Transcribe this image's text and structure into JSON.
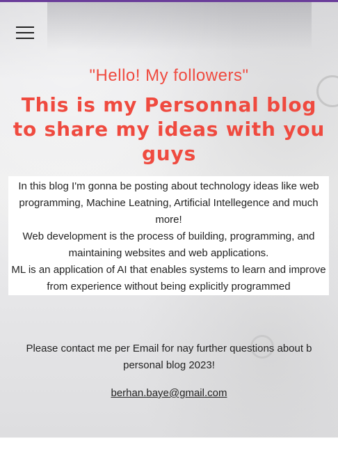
{
  "nav": {
    "menu_icon": "hamburger-menu-icon"
  },
  "hero": {
    "greeting": "\"Hello! My followers\"",
    "headline": "This is my Personnal blog to share my ideas with you guys",
    "paragraphs": [
      "In this blog I'm gonna be posting about technology ideas like web programming, Machine Leatning, Artificial Intellegence and much more!",
      "Web development is the process of building, programming, and maintaining websites and web applications.",
      "ML is an application of AI that enables systems to learn and improve from experience without being explicitly programmed"
    ]
  },
  "contact": {
    "text": "Please contact me per Email for nay further questions about b personal blog 2023!",
    "email": "berhan.baye@gmail.com"
  },
  "colors": {
    "accent": "#ef4a3f",
    "top_bar": "#6a3d9a",
    "text": "#222222"
  }
}
